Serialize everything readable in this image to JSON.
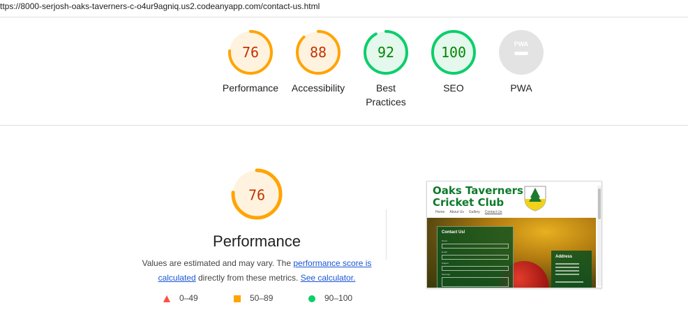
{
  "url": "ttps://8000-serjosh-oaks-taverners-c-o4ur9agniq.us2.codeanyapp.com/contact-us.html",
  "gauges": [
    {
      "label": "Performance",
      "score": "76",
      "value": 76,
      "color": "#ffa400",
      "text_color": "#c33300",
      "bg": "#fff3e0"
    },
    {
      "label": "Accessibility",
      "score": "88",
      "value": 88,
      "color": "#ffa400",
      "text_color": "#c33300",
      "bg": "#fff3e0"
    },
    {
      "label": "Best Practices",
      "score": "92",
      "value": 92,
      "color": "#0cce6b",
      "text_color": "#008800",
      "bg": "#e5f8ed"
    },
    {
      "label": "SEO",
      "score": "100",
      "value": 100,
      "color": "#0cce6b",
      "text_color": "#008800",
      "bg": "#e5f8ed"
    },
    {
      "label": "PWA",
      "score": "",
      "value": 0,
      "color": "#cccccc",
      "text_color": "#ffffff",
      "bg": "#e3e3e3"
    }
  ],
  "pwa_badge_text": "PWA",
  "performance": {
    "score": "76",
    "value": 76,
    "title": "Performance",
    "desc_1": "Values are estimated and may vary. The ",
    "link_score": "performance score is calculated",
    "desc_2": " directly from these metrics. ",
    "link_calc": "See calculator."
  },
  "legend": [
    {
      "range": "0–49",
      "shape": "triangle",
      "color": "#ff4e42"
    },
    {
      "range": "50–89",
      "shape": "square",
      "color": "#ffa400"
    },
    {
      "range": "90–100",
      "shape": "circle",
      "color": "#0cce6b"
    }
  ],
  "screenshot": {
    "club_name": "Oaks Taverners Cricket Club",
    "nav": [
      "Home",
      "About Us",
      "Gallery",
      "Contact Us"
    ],
    "form_title": "Contact Us!",
    "form_labels": [
      "Name",
      "Email",
      "Subject",
      "Message"
    ],
    "address_title": "Address"
  }
}
